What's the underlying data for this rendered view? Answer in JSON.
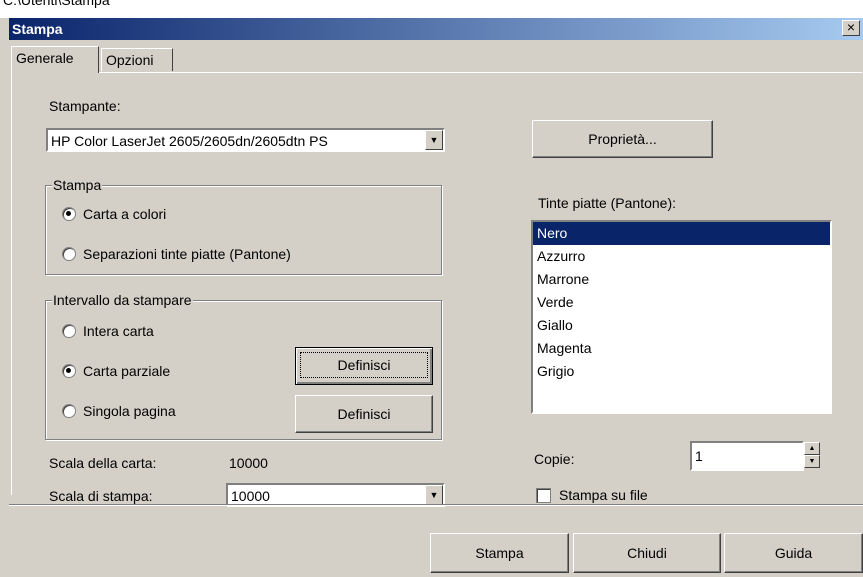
{
  "window": {
    "title": "Stampa",
    "close_label": "×",
    "partial_top_text": "C:\\Utenti\\Stampa"
  },
  "tabs": [
    {
      "label": "Generale"
    },
    {
      "label": "Opzioni"
    }
  ],
  "printer": {
    "label": "Stampante:",
    "value": "HP Color LaserJet 2605/2605dn/2605dtn PS",
    "properties_button": "Proprietà..."
  },
  "print_group": {
    "legend": "Stampa",
    "options": [
      {
        "label": "Carta a colori",
        "selected": true
      },
      {
        "label": "Separazioni tinte piatte (Pantone)",
        "selected": false
      }
    ]
  },
  "range_group": {
    "legend": "Intervallo da stampare",
    "options": [
      {
        "label": "Intera carta",
        "selected": false
      },
      {
        "label": "Carta parziale",
        "selected": true
      },
      {
        "label": "Singola pagina",
        "selected": false
      }
    ],
    "define_button_1": "Definisci",
    "define_button_2": "Definisci"
  },
  "scale": {
    "map_label": "Scala della carta:",
    "map_value": "10000",
    "print_label": "Scala di stampa:",
    "print_value": "10000"
  },
  "spot_colors": {
    "label": "Tinte piatte (Pantone):",
    "items": [
      "Nero",
      "Azzurro",
      "Marrone",
      "Verde",
      "Giallo",
      "Magenta",
      "Grigio"
    ],
    "selected": "Nero"
  },
  "copies": {
    "label": "Copie:",
    "value": "1"
  },
  "print_to_file": {
    "label": "Stampa su file",
    "checked": false
  },
  "footer": {
    "print_button": "Stampa",
    "close_button": "Chiudi",
    "help_button": "Guida"
  },
  "colors": {
    "titlebar_start": "#0a246a",
    "titlebar_end": "#a6caf0",
    "dialog_bg": "#d4d0c8",
    "selection": "#0a246a"
  }
}
